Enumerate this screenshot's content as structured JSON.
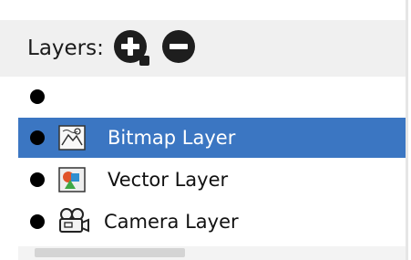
{
  "layers_panel": {
    "title": "Layers:",
    "add_button_icon": "add-layer-icon",
    "remove_button_icon": "remove-layer-icon",
    "selection_color": "#3b76c2",
    "rows": [
      {
        "label": "",
        "icon": null,
        "selected": false
      },
      {
        "label": "Bitmap Layer",
        "icon": "bitmap-layer-icon",
        "selected": true
      },
      {
        "label": "Vector Layer",
        "icon": "vector-layer-icon",
        "selected": false
      },
      {
        "label": "Camera Layer",
        "icon": "camera-layer-icon",
        "selected": false
      }
    ]
  }
}
